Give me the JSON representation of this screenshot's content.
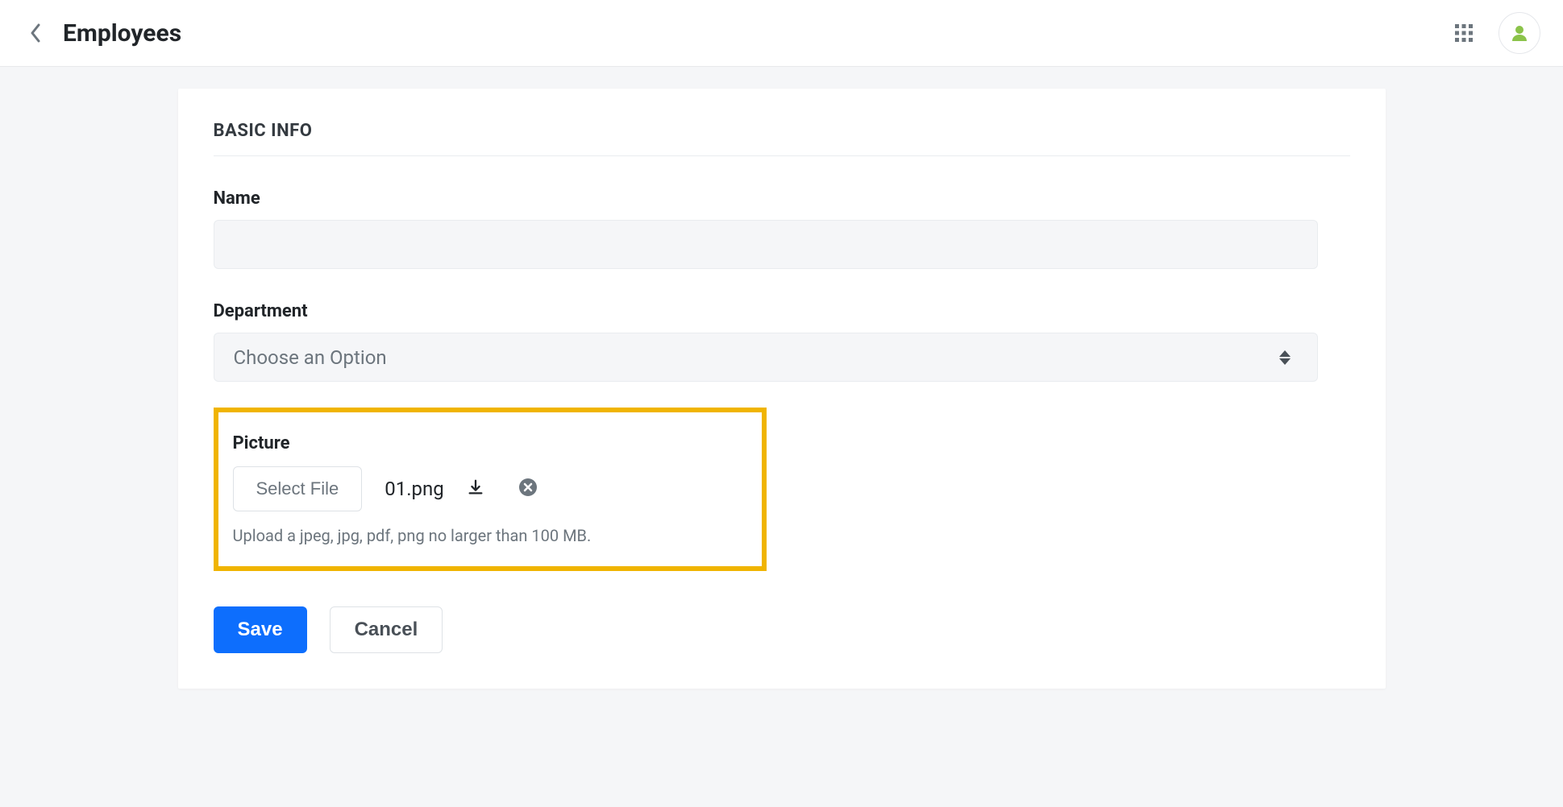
{
  "header": {
    "title": "Employees"
  },
  "form": {
    "section_title": "BASIC INFO",
    "name": {
      "label": "Name",
      "value": ""
    },
    "department": {
      "label": "Department",
      "placeholder": "Choose an Option"
    },
    "picture": {
      "label": "Picture",
      "select_file_label": "Select File",
      "file_name": "01.png",
      "hint": "Upload a jpeg, jpg, pdf, png no larger than 100 MB."
    }
  },
  "actions": {
    "save": "Save",
    "cancel": "Cancel"
  }
}
